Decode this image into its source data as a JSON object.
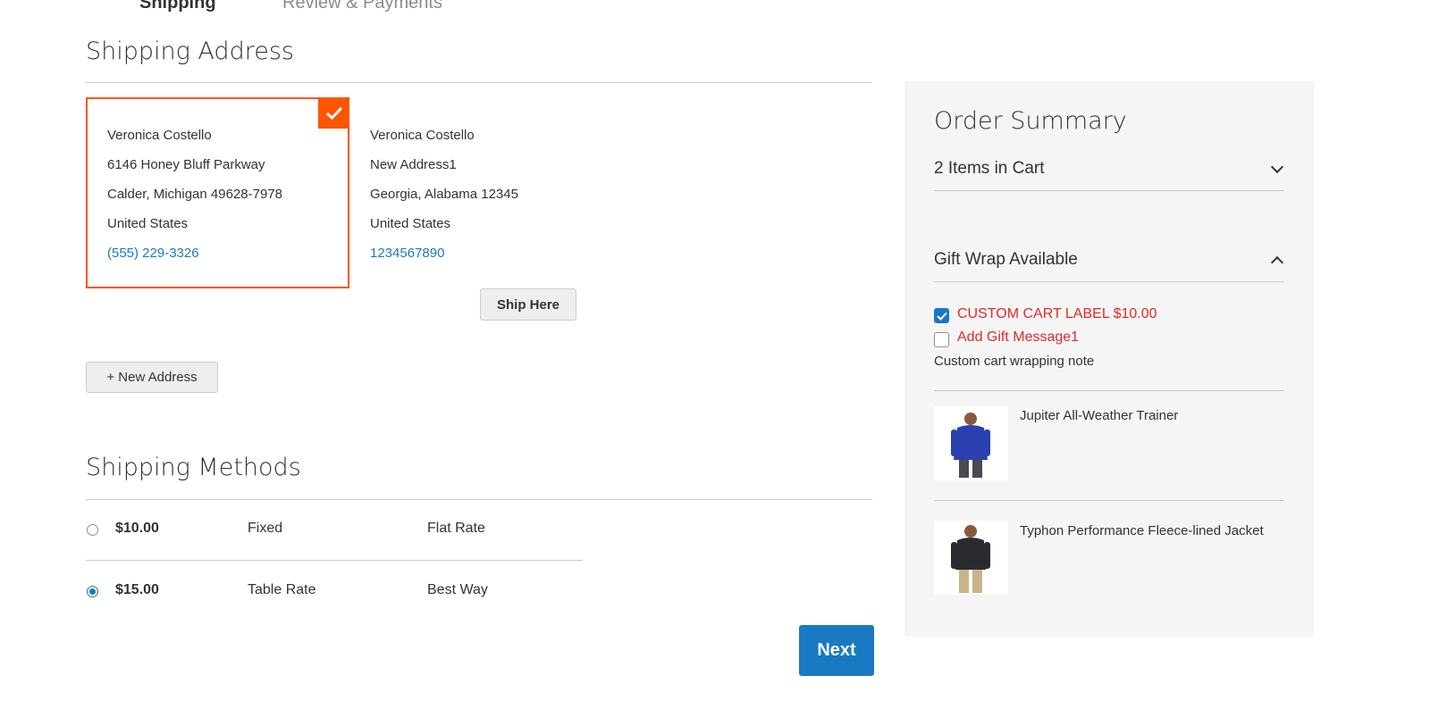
{
  "steps": [
    {
      "label": "Shipping",
      "active": true
    },
    {
      "label": "Review & Payments",
      "active": false
    }
  ],
  "shipping_address": {
    "title": "Shipping Address",
    "addresses": [
      {
        "name": "Veronica Costello",
        "street": "6146 Honey Bluff Parkway",
        "city_line": "Calder, Michigan 49628-7978",
        "country": "United States",
        "phone": "(555) 229-3326",
        "selected": true
      },
      {
        "name": "Veronica Costello",
        "street": "New Address1",
        "city_line": "Georgia, Alabama 12345",
        "country": "United States",
        "phone": "1234567890",
        "selected": false,
        "action_label": "Ship Here"
      }
    ],
    "new_address_label": "+ New Address"
  },
  "shipping_methods": {
    "title": "Shipping Methods",
    "methods": [
      {
        "price": "$10.00",
        "method": "Fixed",
        "carrier": "Flat Rate",
        "selected": false
      },
      {
        "price": "$15.00",
        "method": "Table Rate",
        "carrier": "Best Way",
        "selected": true
      }
    ],
    "next_label": "Next"
  },
  "order_summary": {
    "title": "Order Summary",
    "items_in_cart": "2 Items in Cart",
    "gift_wrap": {
      "title": "Gift Wrap Available",
      "options": [
        {
          "label": "CUSTOM CART LABEL $10.00",
          "checked": true
        },
        {
          "label": "Add Gift Message1",
          "checked": false
        }
      ],
      "note": "Custom cart wrapping note"
    },
    "products": [
      {
        "name": "Jupiter All-Weather Trainer",
        "jacket_color": "#2a3fb0"
      },
      {
        "name": "Typhon Performance Fleece-lined Jacket",
        "jacket_color": "#2b2b2f"
      }
    ]
  },
  "colors": {
    "accent_orange": "#ff5501",
    "link_blue": "#1979c3",
    "gift_red": "#e02b27"
  }
}
